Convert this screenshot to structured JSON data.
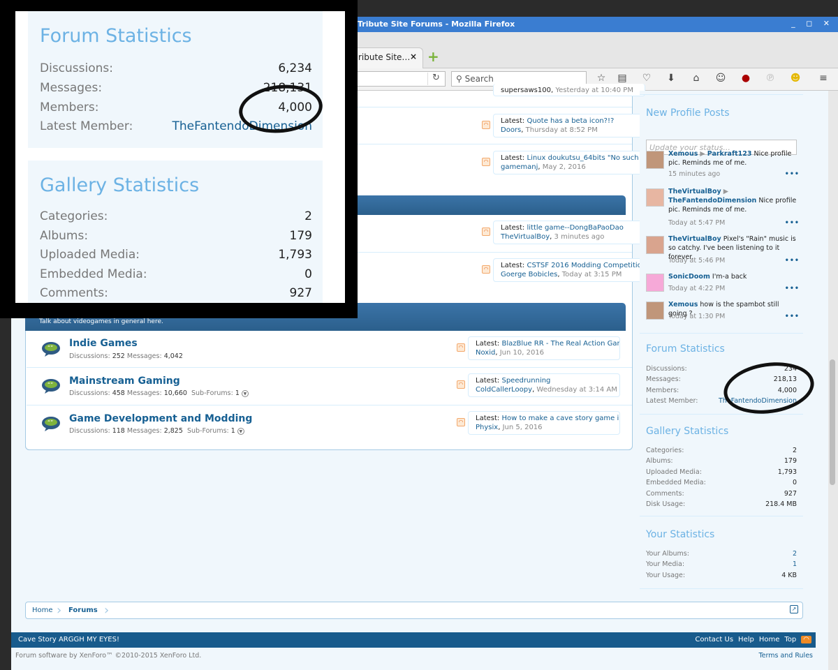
{
  "window": {
    "title": "Tribute Site Forums - Mozilla Firefox",
    "tab_label": "ribute Site…",
    "tab_close": "×",
    "new_tab": "+",
    "window_controls": "_ ◻ ✕"
  },
  "toolbar": {
    "search_placeholder": "Search",
    "reload": "↻"
  },
  "forum_rows_top": [
    {
      "prefix": "Latest:",
      "subject": "Quote has a beta icon?!?",
      "author": "Doors",
      "time": "Thursday at 8:52 PM"
    },
    {
      "prefix": "Latest:",
      "subject": "Linux doukutsu_64bits \"No such fi...",
      "author": "gamemanj",
      "time": "May 2, 2016"
    }
  ],
  "partial_top": {
    "author": "supersaws100",
    "time": "Yesterday at 10:40 PM"
  },
  "forum_rows_mid": [
    {
      "prefix": "Latest:",
      "subject": "little game--DongBaPaoDao",
      "author": "TheVirtualBoy",
      "time": "3 minutes ago"
    },
    {
      "prefix": "Latest:",
      "subject": "CSTSF 2016 Modding Competition...",
      "author": "Goerge Bobicles",
      "time": "Today at 3:15 PM"
    }
  ],
  "videogames": {
    "description": "Talk about videogames in general here.",
    "nodes": [
      {
        "title": "Indie Games",
        "disc_label": "Discussions:",
        "disc": "252",
        "msg_label": "Messages:",
        "msg": "4,042",
        "sub_label": "",
        "sub": "",
        "latest": {
          "prefix": "Latest:",
          "subject": "BlazBlue RR - The Real Action Game",
          "author": "Noxid",
          "time": "Jun 10, 2016"
        }
      },
      {
        "title": "Mainstream Gaming",
        "disc_label": "Discussions:",
        "disc": "458",
        "msg_label": "Messages:",
        "msg": "10,660",
        "sub_label": "Sub-Forums:",
        "sub": "1",
        "latest": {
          "prefix": "Latest:",
          "subject": "Speedrunning",
          "author": "ColdCallerLoopy",
          "time": "Wednesday at 3:14 AM"
        }
      },
      {
        "title": "Game Development and Modding",
        "disc_label": "Discussions:",
        "disc": "118",
        "msg_label": "Messages:",
        "msg": "2,825",
        "sub_label": "Sub-Forums:",
        "sub": "1",
        "latest": {
          "prefix": "Latest:",
          "subject": "How to make a cave story game i...",
          "author": "Physix",
          "time": "Jun 5, 2016"
        }
      }
    ]
  },
  "profile_posts": {
    "title": "New Profile Posts",
    "placeholder": "Update your status...",
    "more": "•••",
    "posts": [
      {
        "name": "Xemous",
        "arrow": "▶",
        "target": "Parkraft123",
        "text": "Nice profile pic. Reminds me of me.",
        "when": "15 minutes ago"
      },
      {
        "name": "TheVirtualBoy",
        "arrow": "▶",
        "target": "TheFantendoDimension",
        "text": "Nice profile pic. Reminds me of me.",
        "when": "Today at 5:47 PM"
      },
      {
        "name": "TheVirtualBoy",
        "arrow": "",
        "target": "",
        "text": "Pixel's \"Rain\" music is so catchy. I've been listening to it forever.",
        "when": "Today at 5:46 PM"
      },
      {
        "name": "SonicDoom",
        "arrow": "",
        "target": "",
        "text": "I'm-a back",
        "when": "Today at 4:22 PM"
      },
      {
        "name": "Xemous",
        "arrow": "",
        "target": "",
        "text": "how is the spambot still going ?",
        "when": "Today at 1:30 PM"
      }
    ]
  },
  "forum_stats": {
    "title": "Forum Statistics",
    "discussions_label": "Discussions:",
    "discussions": "6,234",
    "messages_label": "Messages:",
    "messages": "218,131",
    "members_label": "Members:",
    "members": "4,000",
    "latest_label": "Latest Member:",
    "latest": "TheFantendoDimension"
  },
  "sidebar_partial": {
    "discussions": "234",
    "messages": "218,13"
  },
  "gallery_stats": {
    "title": "Gallery Statistics",
    "categories_label": "Categories:",
    "categories": "2",
    "albums_label": "Albums:",
    "albums": "179",
    "uploaded_label": "Uploaded Media:",
    "uploaded": "1,793",
    "embedded_label": "Embedded Media:",
    "embedded": "0",
    "comments_label": "Comments:",
    "comments": "927",
    "disk_label": "Disk Usage:",
    "disk": "218.4 MB"
  },
  "your_stats": {
    "title": "Your Statistics",
    "albums_label": "Your Albums:",
    "albums": "2",
    "media_label": "Your Media:",
    "media": "1",
    "usage_label": "Your Usage:",
    "usage": "4 KB"
  },
  "overlay_stats": {
    "messages_partial": "218,131",
    "latest_partial": "TheFantendoDimension"
  },
  "breadcrumb": {
    "home": "Home",
    "forums": "Forums"
  },
  "footer": {
    "style": "Cave Story ARGGH MY EYES!",
    "contact": "Contact Us",
    "help": "Help",
    "home": "Home",
    "top": "Top",
    "copyright": "Forum software by XenForo™ ©2010-2015 XenForo Ltd.",
    "terms": "Terms and Rules"
  },
  "colors": {
    "brand": "#185b8c",
    "accent": "#6cb2e4",
    "titlebar": "#3a7dd1"
  }
}
